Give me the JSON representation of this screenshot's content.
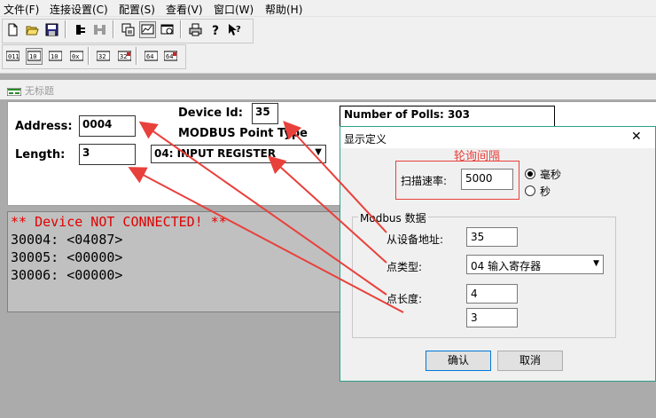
{
  "menu": [
    "文件(F)",
    "连接设置(C)",
    "配置(S)",
    "查看(V)",
    "窗口(W)",
    "帮助(H)"
  ],
  "toolbar1_icons": [
    "new-file-icon",
    "open-folder-icon",
    "save-icon",
    "connect-icon",
    "disconnect-icon",
    "poll-settings-icon",
    "chart-icon",
    "window-icon",
    "print-icon",
    "help-icon",
    "context-help-icon"
  ],
  "toolbar2_icons": [
    "fc01-icon",
    "fc03-icon",
    "fc04-icon",
    "fc05-icon",
    "fc15-icon",
    "fc16-icon",
    "fc06-icon",
    "fc22-icon"
  ],
  "child": {
    "title": "无标题",
    "address_label": "Address:",
    "address_value": "0004",
    "length_label": "Length:",
    "length_value": "3",
    "device_id_label": "Device Id:",
    "device_id_value": "35",
    "point_type_label": "MODBUS Point Type",
    "point_type_value": "04: INPUT REGISTER",
    "polls_text": "Number of Polls: 303"
  },
  "console_lines": [
    {
      "text": "** Device NOT CONNECTED! **",
      "color": "#e00000"
    },
    {
      "text": "30004: <04087>",
      "color": "#000000"
    },
    {
      "text": "30005: <00000>",
      "color": "#000000"
    },
    {
      "text": "30006: <00000>",
      "color": "#000000"
    }
  ],
  "dialog": {
    "title": "显示定义",
    "close_glyph": "✕",
    "annotation": "轮询间隔",
    "scan_rate_label": "扫描速率:",
    "scan_rate_value": "5000",
    "radio_ms_label": "毫秒",
    "radio_s_label": "秒",
    "group_title": "Modbus 数据",
    "slave_addr_label": "从设备地址:",
    "slave_addr_value": "35",
    "point_type_label": "点类型:",
    "point_type_value": "04 输入寄存器",
    "point_len_label": "点长度:",
    "point_len_value": "4",
    "extra_value": "3",
    "ok_label": "确认",
    "cancel_label": "取消"
  },
  "colors": {
    "annotation_red": "#e8413c",
    "console_bg": "#c0c0c0",
    "dialog_border": "#2d9e8a"
  }
}
